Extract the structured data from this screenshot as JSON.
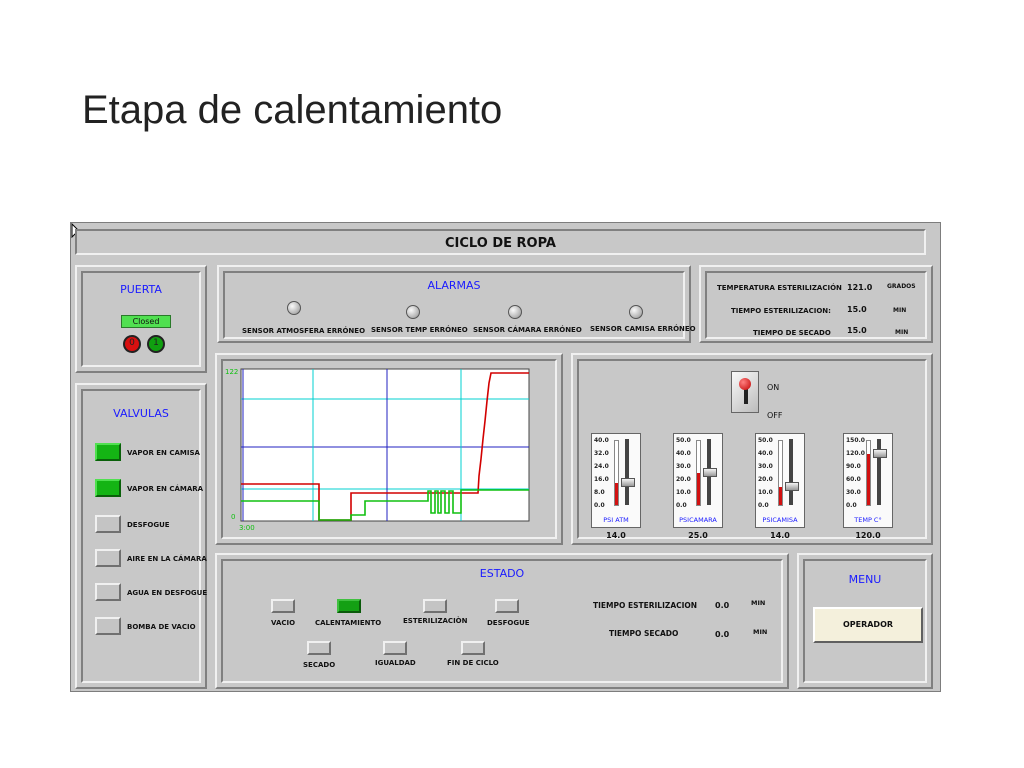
{
  "slide_title": "Etapa de calentamiento",
  "hmi": {
    "title": "CICLO DE ROPA",
    "door": {
      "title": "PUERTA",
      "status": "Closed",
      "open_button": "0",
      "close_button": "1"
    },
    "alarms": {
      "title": "ALARMAS",
      "items": [
        "SENSOR ATMOSFERA ERRÓNEO",
        "SENSOR TEMP ERRÓNEO",
        "SENSOR CÁMARA  ERRÓNEO",
        "SENSOR CAMISA ERRÓNEO"
      ]
    },
    "params": {
      "rows": [
        {
          "label": "TEMPERATURA ESTERILIZACIÓN",
          "value": "121.0",
          "unit": "GRADOS"
        },
        {
          "label": "TIEMPO ESTERILIZACION:",
          "value": "15.0",
          "unit": "MIN"
        },
        {
          "label": "TIEMPO DE SECADO",
          "value": "15.0",
          "unit": "MIN"
        }
      ]
    },
    "valves": {
      "title": "VALVULAS",
      "items": [
        {
          "label": "VAPOR EN CAMISA",
          "on": true
        },
        {
          "label": "VAPOR EN CÁMARA",
          "on": true
        },
        {
          "label": "DESFOGUE",
          "on": false
        },
        {
          "label": "AIRE EN LA CÁMARA",
          "on": false
        },
        {
          "label": "AGUA EN DESFOGUE",
          "on": false
        },
        {
          "label": "BOMBA DE VACIO",
          "on": false
        }
      ]
    },
    "trend": {
      "y_max_label": "122",
      "y_min_label": "0",
      "x_start_label": "3:00",
      "colors": {
        "red": "#d20000",
        "green": "#10c010",
        "cyan": "#00d0d0",
        "blue": "#2020c0"
      }
    },
    "switch": {
      "on_label": "ON",
      "off_label": "OFF"
    },
    "gauges": [
      {
        "name": "PSI ATM",
        "value": "14.0",
        "level": 0.35,
        "ticks": [
          "40.0",
          "32.0",
          "24.0",
          "16.0",
          "8.0",
          "0.0"
        ]
      },
      {
        "name": "PSICAMARA",
        "value": "25.0",
        "level": 0.5,
        "ticks": [
          "50.0",
          "40.0",
          "30.0",
          "20.0",
          "10.0",
          "0.0"
        ]
      },
      {
        "name": "PSICAMISA",
        "value": "14.0",
        "level": 0.28,
        "ticks": [
          "50.0",
          "40.0",
          "30.0",
          "20.0",
          "10.0",
          "0.0"
        ]
      },
      {
        "name": "TEMP C°",
        "value": "120.0",
        "level": 0.8,
        "ticks": [
          "150.0",
          "120.0",
          "90.0",
          "60.0",
          "30.0",
          "0.0"
        ]
      }
    ],
    "estado": {
      "title": "ESTADO",
      "states": [
        {
          "label": "VACIO",
          "on": false
        },
        {
          "label": "CALENTAMIENTO",
          "on": true
        },
        {
          "label": "ESTERILIZACIÒN",
          "on": false
        },
        {
          "label": "DESFOGUE",
          "on": false
        },
        {
          "label": "SECADO",
          "on": false
        },
        {
          "label": "IGUALDAD",
          "on": false
        },
        {
          "label": "FIN DE CICLO",
          "on": false
        }
      ],
      "timers": [
        {
          "label": "TIEMPO ESTERILIZACION",
          "value": "0.0",
          "unit": "MIN"
        },
        {
          "label": "TIEMPO SECADO",
          "value": "0.0",
          "unit": "MIN"
        }
      ]
    },
    "menu": {
      "title": "MENU",
      "operator_button": "OPERADOR"
    }
  }
}
